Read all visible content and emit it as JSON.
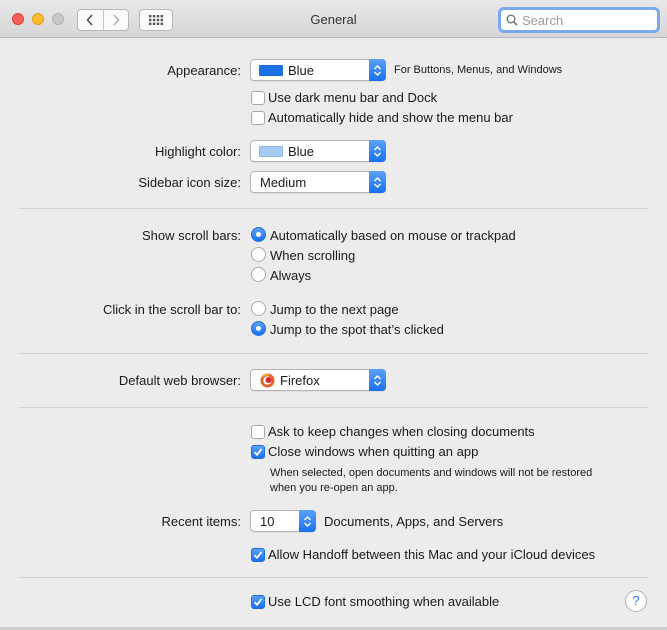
{
  "window": {
    "title": "General",
    "search": {
      "placeholder": "Search",
      "value": ""
    }
  },
  "appearance": {
    "label": "Appearance:",
    "value": "Blue",
    "swatch_color": "#1d6fe8",
    "note": "For Buttons, Menus, and Windows",
    "dark_menu_bar": {
      "label": "Use dark menu bar and Dock",
      "checked": false
    },
    "auto_hide_menu_bar": {
      "label": "Automatically hide and show the menu bar",
      "checked": false
    }
  },
  "highlight": {
    "label": "Highlight color:",
    "value": "Blue",
    "swatch_color": "#a6ccf6"
  },
  "sidebar_icon_size": {
    "label": "Sidebar icon size:",
    "value": "Medium"
  },
  "scroll_bars": {
    "label": "Show scroll bars:",
    "options": [
      {
        "label": "Automatically based on mouse or trackpad",
        "selected": true
      },
      {
        "label": "When scrolling",
        "selected": false
      },
      {
        "label": "Always",
        "selected": false
      }
    ]
  },
  "click_scroll_bar": {
    "label": "Click in the scroll bar to:",
    "options": [
      {
        "label": "Jump to the next page",
        "selected": false
      },
      {
        "label": "Jump to the spot that’s clicked",
        "selected": true
      }
    ]
  },
  "default_browser": {
    "label": "Default web browser:",
    "value": "Firefox"
  },
  "documents": {
    "ask_keep_changes": {
      "label": "Ask to keep changes when closing documents",
      "checked": false
    },
    "close_windows": {
      "label": "Close windows when quitting an app",
      "checked": true
    },
    "note_line1": "When selected, open documents and windows will not be restored",
    "note_line2": "when you re-open an app."
  },
  "recent_items": {
    "label": "Recent items:",
    "value": "10",
    "suffix": "Documents, Apps, and Servers"
  },
  "handoff": {
    "label": "Allow Handoff between this Mac and your iCloud devices",
    "checked": true
  },
  "lcd_smoothing": {
    "label": "Use LCD font smoothing when available",
    "checked": true
  },
  "help": {
    "label": "?"
  },
  "colors": {
    "accent": "#1a6ff0",
    "focus_ring": "#79aaf1"
  }
}
